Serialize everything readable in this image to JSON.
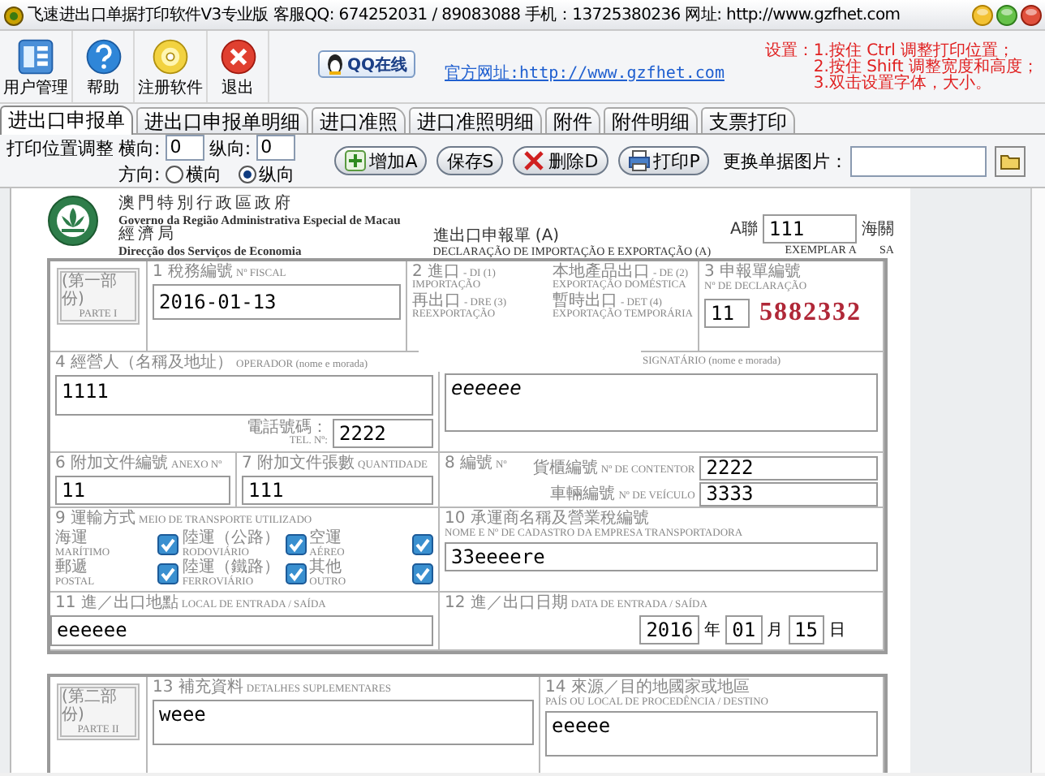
{
  "window": {
    "title": "飞速进出口单据打印软件V3专业版 客服QQ: 674252031 / 89083088 手机：13725380236 网址: http://www.gzfhet.com"
  },
  "toolbar": {
    "buttons": [
      {
        "label": "用户管理",
        "kind": "users"
      },
      {
        "label": "帮助",
        "kind": "help"
      },
      {
        "label": "注册软件",
        "kind": "register"
      },
      {
        "label": "退出",
        "kind": "exit"
      }
    ],
    "qq_button": "QQ在线",
    "website_link": "官方网址:http://www.gzfhet.com",
    "tips": {
      "heading": "设置：",
      "items": [
        "1.按住 Ctrl 调整打印位置；",
        "2.按住 Shift 调整宽度和高度；",
        "3.双击设置字体，大小。"
      ]
    }
  },
  "tabs": [
    {
      "label": "进出口申报单",
      "selected": true
    },
    {
      "label": "进出口申报单明细",
      "selected": false
    },
    {
      "label": "进口准照",
      "selected": false
    },
    {
      "label": "进口准照明细",
      "selected": false
    },
    {
      "label": "附件",
      "selected": false
    },
    {
      "label": "附件明细",
      "selected": false
    },
    {
      "label": "支票打印",
      "selected": false
    }
  ],
  "print_adjust": {
    "label": "打印位置调整",
    "horizontal_label": "横向:",
    "horizontal_value": "0",
    "vertical_label": "纵向:",
    "vertical_value": "0",
    "direction_label": "方向:",
    "orientations": [
      {
        "label": "横向",
        "selected": false
      },
      {
        "label": "纵向",
        "selected": true
      }
    ]
  },
  "actions": [
    {
      "label": "增加A",
      "kind": "add"
    },
    {
      "label": "保存S",
      "kind": "save"
    },
    {
      "label": "删除D",
      "kind": "delete"
    },
    {
      "label": "打印P",
      "kind": "print"
    }
  ],
  "image_picker": {
    "label": "更换单据图片："
  },
  "form": {
    "header": {
      "gov_zh": "澳門特別行政區政府",
      "gov_pt": "Governo da Região Administrativa Especial de Macau",
      "dept_zh": "經濟局",
      "dept_pt": "Direcção dos Serviços de Economia"
    },
    "title_zh": "進出口申報單 (A)",
    "title_pt": "DECLARAÇÃO DE IMPORTAÇÃO E EXPORTAÇÃO (A)",
    "copy": {
      "label_zh": "A聯",
      "value": "111",
      "label_pt": "EXEMPLAR A"
    },
    "customs": {
      "zh": "海關",
      "pt": "SA"
    },
    "part1": {
      "zh": "(第一部份)",
      "pt": "PARTE I"
    },
    "fiscal": {
      "zh": "1 稅務編號",
      "pt": "Nº FISCAL",
      "value": "2016-01-13"
    },
    "declaration_types": [
      {
        "zh": "2 進口",
        "code": "- DI (1)",
        "pt": "IMPORTAÇÃO"
      },
      {
        "zh": "本地產品出口",
        "code": "- DE (2)",
        "pt": "EXPORTAÇÃO DOMÉSTICA"
      },
      {
        "zh": "再出口",
        "code": "- DRE (3)",
        "pt": "REEXPORTAÇÃO"
      },
      {
        "zh": "暫時出口",
        "code": "- DET (4)",
        "pt": "EXPORTAÇÃO TEMPORÁRIA"
      }
    ],
    "declaration_no": {
      "zh": "3 申報單編號",
      "pt": "Nº DE DECLARAÇÃO",
      "prefix": "11",
      "number": "5882332"
    },
    "operator": {
      "zh": "4 經營人（名稱及地址）",
      "pt": "OPERADOR (nome e morada)",
      "value": "1111",
      "tel_zh": "電話號碼：",
      "tel_pt": "TEL. Nº:",
      "tel_value": "2222"
    },
    "signatory": {
      "pt": "SIGNATÁRIO (nome e morada)",
      "value": "eeeeee"
    },
    "annex": {
      "zh": "6 附加文件編號",
      "pt": "ANEXO Nº",
      "value": "11"
    },
    "quantity": {
      "zh": "7 附加文件張數",
      "pt": "QUANTIDADE",
      "value": "111"
    },
    "numbers": {
      "zh": "8 編號",
      "pt": "Nº",
      "container_zh": "貨櫃編號",
      "container_pt": "Nº DE CONTENTOR",
      "container_value": "2222",
      "vehicle_zh": "車輛編號",
      "vehicle_pt": "Nº DE VEÍCULO",
      "vehicle_value": "3333"
    },
    "transport": {
      "zh": "9 運輸方式",
      "pt": "MEIO DE TRANSPORTE UTILIZADO",
      "modes": [
        {
          "zh": "海運",
          "pt": "MARÍTIMO",
          "checked": true
        },
        {
          "zh": "陸運（公路）",
          "pt": "RODOVIÁRIO",
          "checked": true
        },
        {
          "zh": "空運",
          "pt": "AÉREO",
          "checked": true
        },
        {
          "zh": "郵遞",
          "pt": "POSTAL",
          "checked": true
        },
        {
          "zh": "陸運（鐵路）",
          "pt": "FERROVIÁRIO",
          "checked": true
        },
        {
          "zh": "其他",
          "pt": "OUTRO",
          "checked": true
        }
      ]
    },
    "carrier": {
      "zh": "10 承運商名稱及營業稅編號",
      "pt": "NOME E Nº DE CADASTRO DA EMPRESA TRANSPORTADORA",
      "value": "33eeeere"
    },
    "entry_place": {
      "zh": "11 進／出口地點",
      "pt": "LOCAL DE ENTRADA / SAÍDA",
      "value": "eeeeee"
    },
    "entry_date": {
      "zh": "12 進／出口日期",
      "pt": "DATA DE ENTRADA / SAÍDA",
      "year": "2016",
      "year_unit": "年",
      "month": "01",
      "month_unit": "月",
      "day": "15",
      "day_unit": "日"
    },
    "part2": {
      "zh": "(第二部份)",
      "pt": "PARTE II"
    },
    "details": {
      "zh": "13 補充資料",
      "pt": "DETALHES SUPLEMENTARES",
      "value": "weee"
    },
    "origin": {
      "zh": "14 來源／目的地國家或地區",
      "pt": "PAÍS OU LOCAL DE PROCEDÊNCIA / DESTINO",
      "value": "eeeee"
    }
  }
}
